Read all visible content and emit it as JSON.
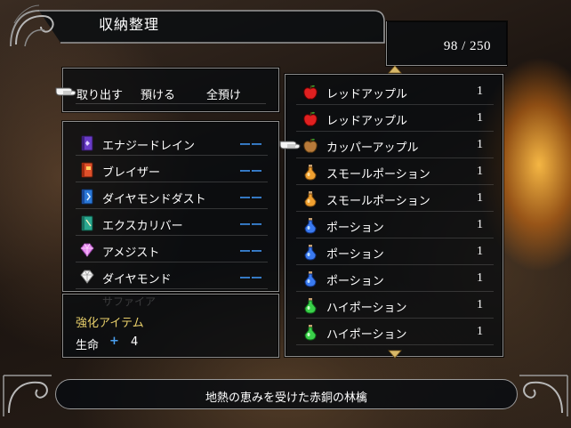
{
  "title": "収納整理",
  "counter": {
    "current": "98",
    "separator": "/",
    "max": "250",
    "text": "98  /  250"
  },
  "commands": [
    {
      "label": "取り出す"
    },
    {
      "label": "預ける"
    },
    {
      "label": "全預け"
    }
  ],
  "materials": [
    {
      "name": "エナジードレイン",
      "qty": "ーー",
      "icon": "purple-book-icon"
    },
    {
      "name": "ブレイザー",
      "qty": "ーー",
      "icon": "red-book-icon"
    },
    {
      "name": "ダイヤモンドダスト",
      "qty": "ーー",
      "icon": "blue-book-icon"
    },
    {
      "name": "エクスカリバー",
      "qty": "ーー",
      "icon": "green-book-icon"
    },
    {
      "name": "アメジスト",
      "qty": "ーー",
      "icon": "amethyst-gem-icon"
    },
    {
      "name": "ダイヤモンド",
      "qty": "ーー",
      "icon": "diamond-gem-icon"
    }
  ],
  "enhance": {
    "peek": "サファイア",
    "title": "強化アイテム",
    "stat_label": "生命",
    "plus": "+",
    "value": "4"
  },
  "items": [
    {
      "name": "レッドアップル",
      "qty": "1",
      "icon": "red-apple-icon"
    },
    {
      "name": "レッドアップル",
      "qty": "1",
      "icon": "red-apple-icon"
    },
    {
      "name": "カッパーアップル",
      "qty": "1",
      "icon": "copper-apple-icon"
    },
    {
      "name": "スモールポーション",
      "qty": "1",
      "icon": "orange-potion-icon"
    },
    {
      "name": "スモールポーション",
      "qty": "1",
      "icon": "orange-potion-icon"
    },
    {
      "name": "ポーション",
      "qty": "1",
      "icon": "blue-potion-icon"
    },
    {
      "name": "ポーション",
      "qty": "1",
      "icon": "blue-potion-icon"
    },
    {
      "name": "ポーション",
      "qty": "1",
      "icon": "blue-potion-icon"
    },
    {
      "name": "ハイポーション",
      "qty": "1",
      "icon": "green-potion-icon"
    },
    {
      "name": "ハイポーション",
      "qty": "1",
      "icon": "green-potion-icon"
    }
  ],
  "help": "地熱の恵みを受けた赤銅の林檎",
  "colors": {
    "panel_bg": "#080c10",
    "border": "#8d8d8d",
    "quantity_dash": "#3d8ee6",
    "enhance_title": "#e8cf6a",
    "cursor_arrow": "#d8b868"
  }
}
